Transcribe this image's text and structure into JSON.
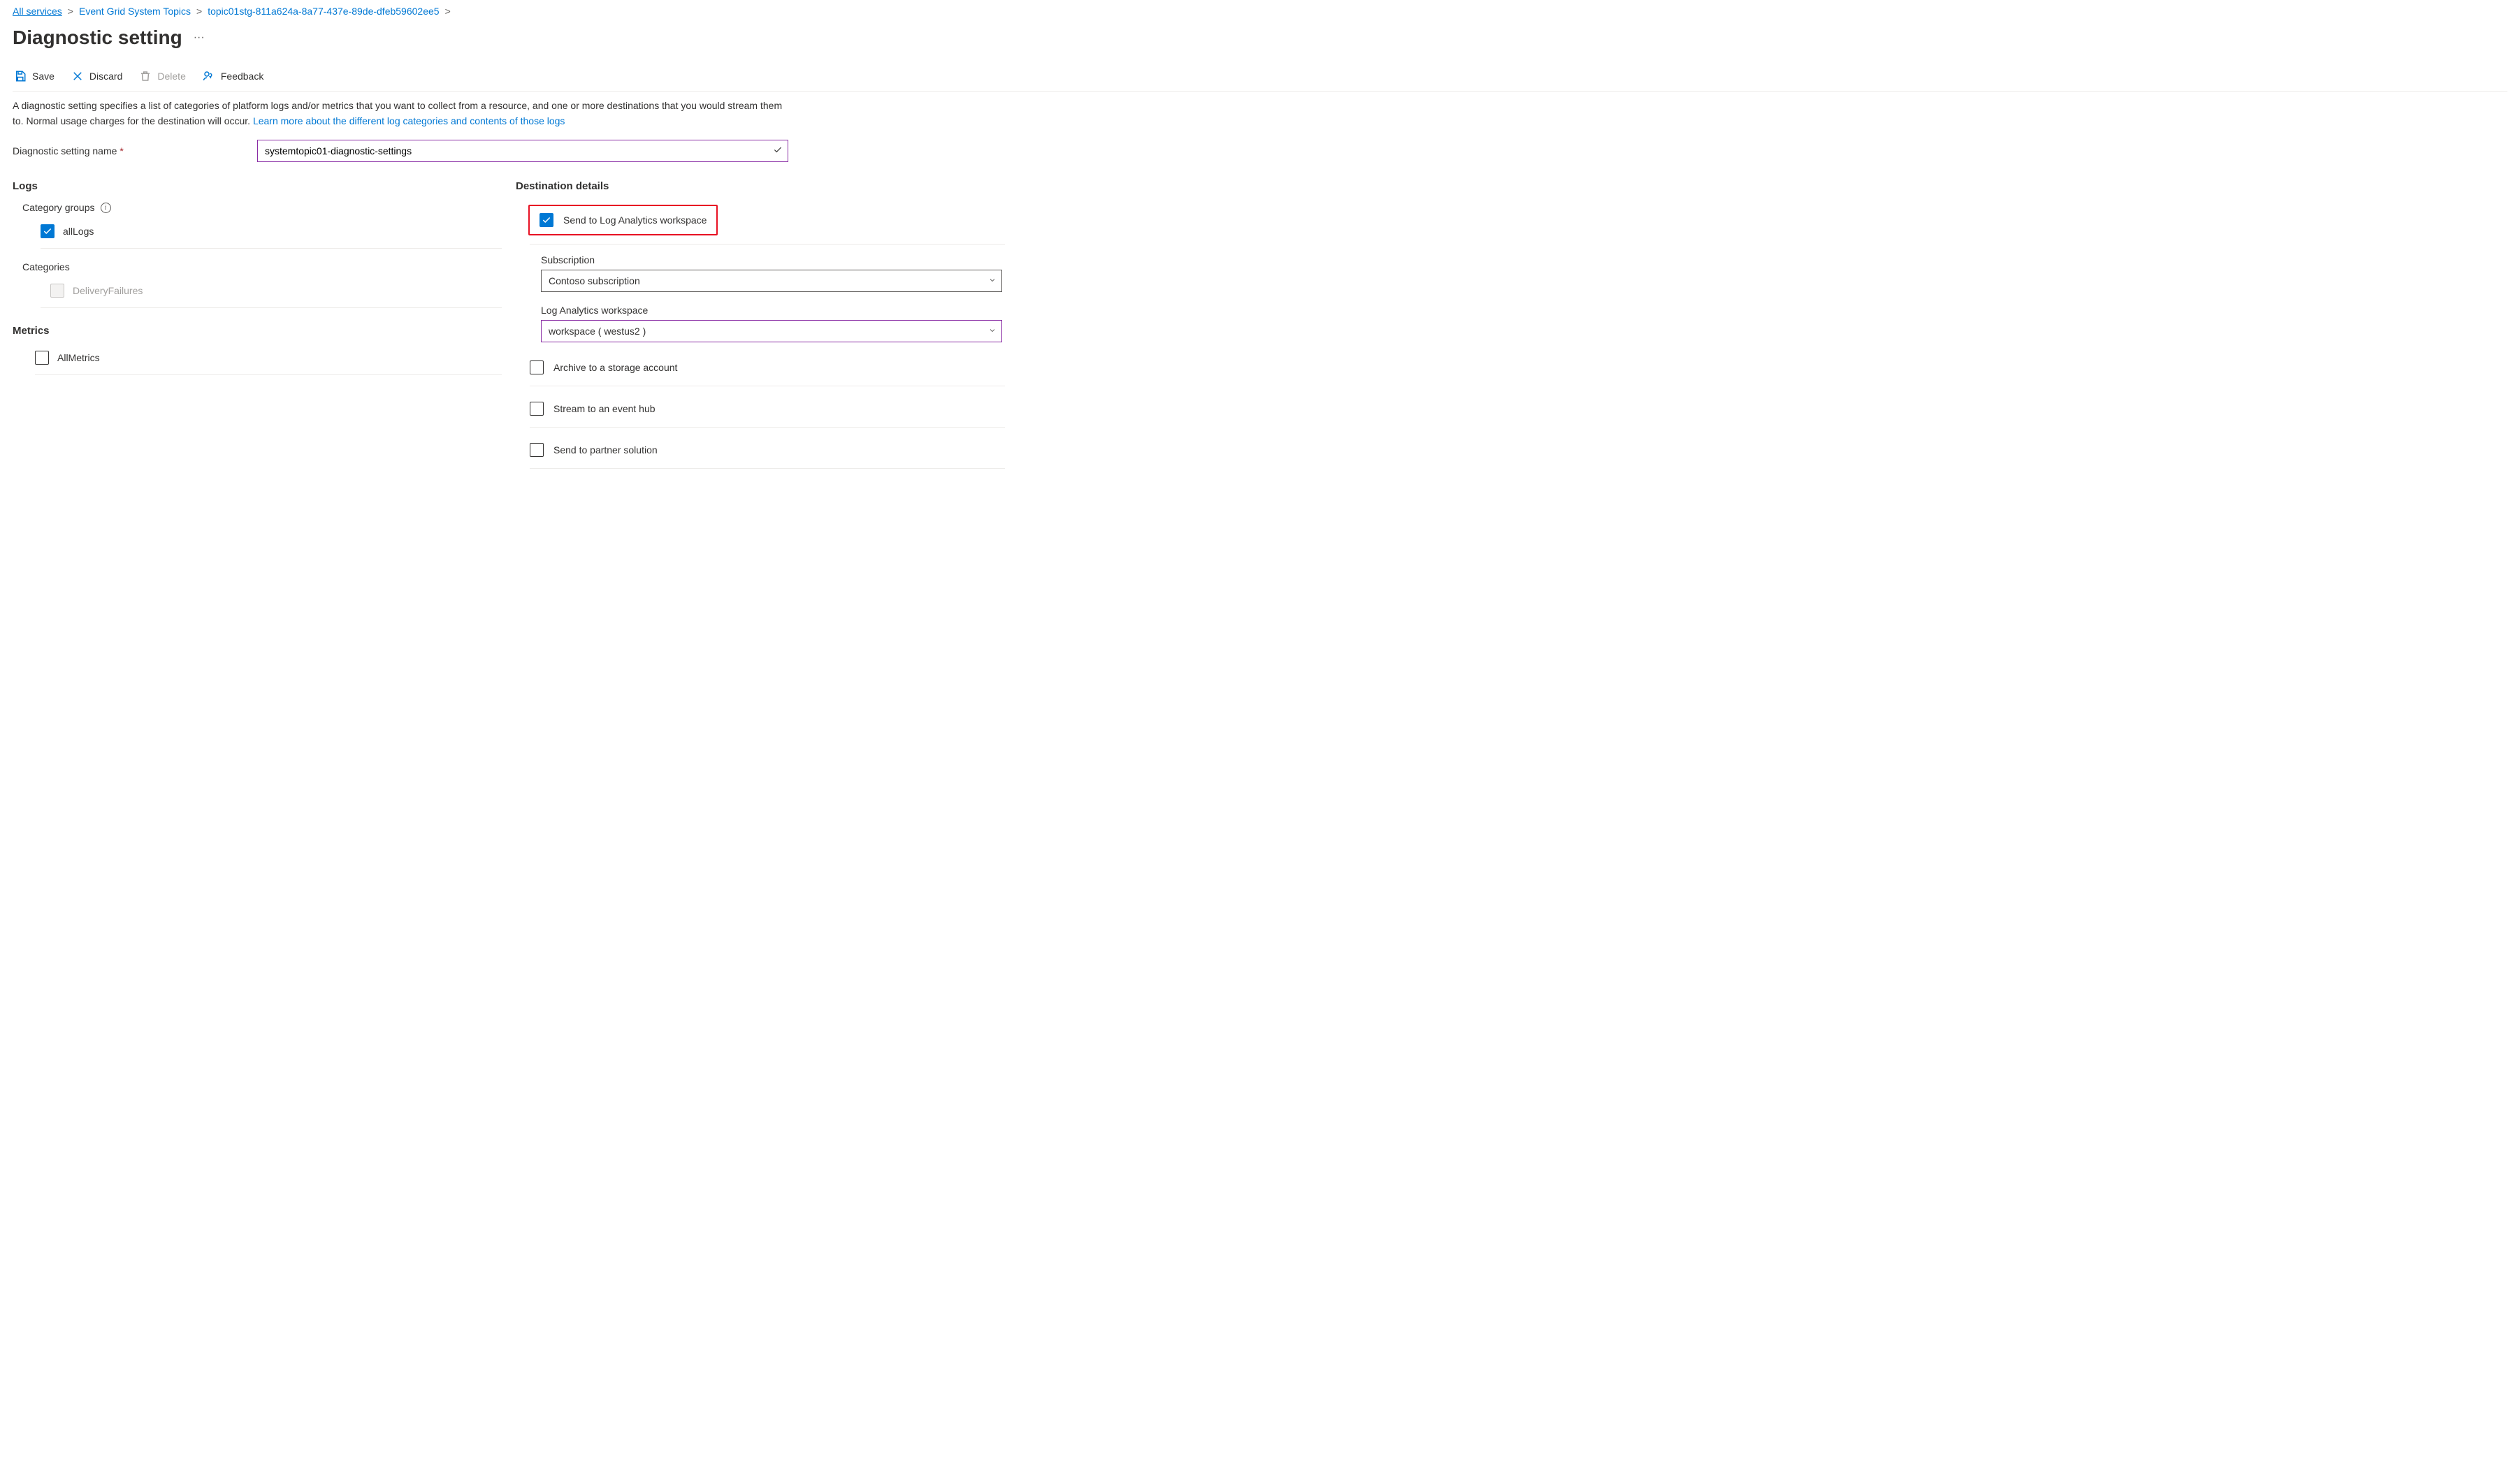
{
  "breadcrumb": {
    "items": [
      {
        "label": "All services",
        "underlined": true
      },
      {
        "label": "Event Grid System Topics"
      },
      {
        "label": "topic01stg-811a624a-8a77-437e-89de-dfeb59602ee5"
      }
    ],
    "sep": ">"
  },
  "page": {
    "title": "Diagnostic setting"
  },
  "toolbar": {
    "save": "Save",
    "discard": "Discard",
    "delete": "Delete",
    "feedback": "Feedback"
  },
  "description": {
    "text": "A diagnostic setting specifies a list of categories of platform logs and/or metrics that you want to collect from a resource, and one or more destinations that you would stream them to. Normal usage charges for the destination will occur. ",
    "link": "Learn more about the different log categories and contents of those logs"
  },
  "setting_name": {
    "label": "Diagnostic setting name",
    "value": "systemtopic01-diagnostic-settings"
  },
  "logs": {
    "heading": "Logs",
    "category_groups_label": "Category groups",
    "all_logs": "allLogs",
    "categories_label": "Categories",
    "delivery_failures": "DeliveryFailures"
  },
  "metrics": {
    "heading": "Metrics",
    "all_metrics": "AllMetrics"
  },
  "destinations": {
    "heading": "Destination details",
    "log_analytics": "Send to Log Analytics workspace",
    "subscription_label": "Subscription",
    "subscription_value": "Contoso subscription",
    "workspace_label": "Log Analytics workspace",
    "workspace_value": "workspace ( westus2 )",
    "storage": "Archive to a storage account",
    "eventhub": "Stream to an event hub",
    "partner": "Send to partner solution"
  }
}
